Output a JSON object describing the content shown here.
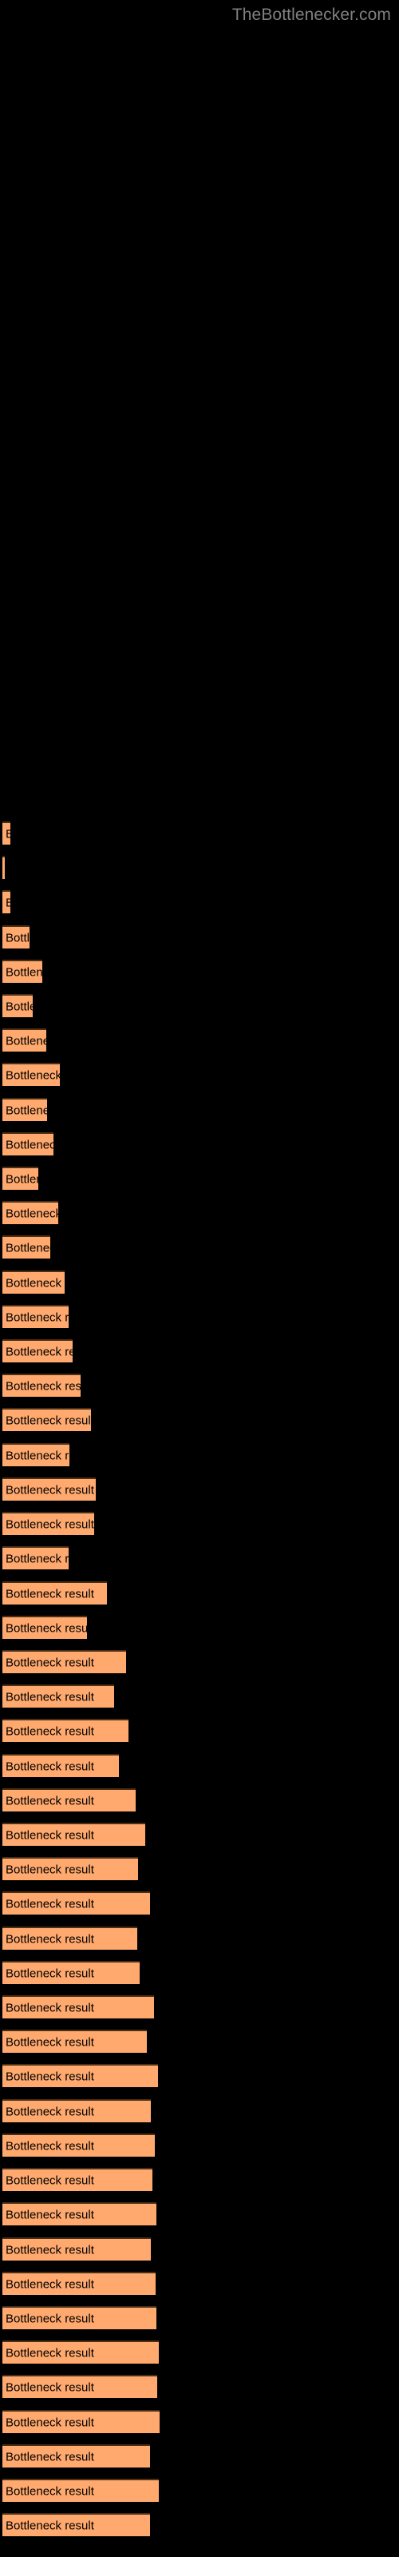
{
  "header": {
    "brand": "TheBottlenecker.com"
  },
  "colors": {
    "background": "#000000",
    "bar_fill": "#ffa96e",
    "bar_border": "#4a2e15",
    "bar_label": "#000000",
    "brand_text": "#808080"
  },
  "chart_data": {
    "type": "bar",
    "orientation": "horizontal",
    "title": "",
    "subtitle": "",
    "xlabel": "",
    "ylabel": "",
    "grid": false,
    "legend": null,
    "xlim": [
      0,
      500
    ],
    "bar_label_text": "Bottleneck result",
    "categories": [
      "Bottleneck result",
      "Bottleneck result",
      "Bottleneck result",
      "Bottleneck result",
      "Bottleneck result",
      "Bottleneck result",
      "Bottleneck result",
      "Bottleneck result",
      "Bottleneck result",
      "Bottleneck result",
      "Bottleneck result",
      "Bottleneck result",
      "Bottleneck result",
      "Bottleneck result",
      "Bottleneck result",
      "Bottleneck result",
      "Bottleneck result",
      "Bottleneck result",
      "Bottleneck result",
      "Bottleneck result",
      "Bottleneck result",
      "Bottleneck result"
    ],
    "values": [
      10,
      3,
      10,
      34,
      50,
      38,
      55,
      72,
      56,
      64,
      45,
      70,
      60,
      78,
      83,
      88,
      82,
      93,
      98,
      103,
      108,
      115
    ],
    "bars": [
      {
        "label": "Bottleneck result",
        "y": 1028,
        "width": 10
      },
      {
        "label": "Bottleneck result",
        "y": 1071,
        "width": 3
      },
      {
        "label": "Bottleneck result",
        "y": 1114,
        "width": 10
      },
      {
        "label": "Bottleneck result",
        "y": 1158,
        "width": 34
      },
      {
        "label": "Bottleneck result",
        "y": 1201,
        "width": 50
      },
      {
        "label": "Bottleneck result",
        "y": 1244,
        "width": 38
      },
      {
        "label": "Bottleneck result",
        "y": 1287,
        "width": 55
      },
      {
        "label": "Bottleneck result",
        "y": 1330,
        "width": 72
      },
      {
        "label": "Bottleneck result",
        "y": 1374,
        "width": 56
      },
      {
        "label": "Bottleneck result",
        "y": 1417,
        "width": 64
      },
      {
        "label": "Bottleneck result",
        "y": 1460,
        "width": 45
      },
      {
        "label": "Bottleneck result",
        "y": 1503,
        "width": 70
      },
      {
        "label": "Bottleneck result",
        "y": 1546,
        "width": 60
      },
      {
        "label": "Bottleneck result",
        "y": 1590,
        "width": 78
      },
      {
        "label": "Bottleneck result",
        "y": 1633,
        "width": 83
      },
      {
        "label": "Bottleneck result",
        "y": 1676,
        "width": 88
      },
      {
        "label": "Bottleneck result",
        "y": 1719,
        "width": 98
      },
      {
        "label": "Bottleneck result",
        "y": 1762,
        "width": 111
      },
      {
        "label": "Bottleneck result",
        "y": 1806,
        "width": 84
      },
      {
        "label": "Bottleneck result",
        "y": 1849,
        "width": 117
      },
      {
        "label": "Bottleneck result",
        "y": 1892,
        "width": 115
      },
      {
        "label": "Bottleneck result",
        "y": 1935,
        "width": 83
      },
      {
        "label": "Bottleneck result",
        "y": 1979,
        "width": 131
      },
      {
        "label": "Bottleneck result",
        "y": 2022,
        "width": 106
      },
      {
        "label": "Bottleneck result",
        "y": 2065,
        "width": 155
      },
      {
        "label": "Bottleneck result",
        "y": 2108,
        "width": 140
      },
      {
        "label": "Bottleneck result",
        "y": 2151,
        "width": 158
      },
      {
        "label": "Bottleneck result",
        "y": 2195,
        "width": 146
      },
      {
        "label": "Bottleneck result",
        "y": 2238,
        "width": 167
      },
      {
        "label": "Bottleneck result",
        "y": 2281,
        "width": 179
      },
      {
        "label": "Bottleneck result",
        "y": 2324,
        "width": 170
      },
      {
        "label": "Bottleneck result",
        "y": 2367,
        "width": 185
      },
      {
        "label": "Bottleneck result",
        "y": 2411,
        "width": 169
      },
      {
        "label": "Bottleneck result",
        "y": 2454,
        "width": 172
      },
      {
        "label": "Bottleneck result",
        "y": 2497,
        "width": 190
      },
      {
        "label": "Bottleneck result",
        "y": 2540,
        "width": 181
      },
      {
        "label": "Bottleneck result",
        "y": 2583,
        "width": 195
      },
      {
        "label": "Bottleneck result",
        "y": 2627,
        "width": 186
      },
      {
        "label": "Bottleneck result",
        "y": 2670,
        "width": 191
      },
      {
        "label": "Bottleneck result",
        "y": 2713,
        "width": 188
      },
      {
        "label": "Bottleneck result",
        "y": 2756,
        "width": 193
      },
      {
        "label": "Bottleneck result",
        "y": 2800,
        "width": 186
      },
      {
        "label": "Bottleneck result",
        "y": 2843,
        "width": 192
      },
      {
        "label": "Bottleneck result",
        "y": 2886,
        "width": 193
      },
      {
        "label": "Bottleneck result",
        "y": 2929,
        "width": 196
      },
      {
        "label": "Bottleneck result",
        "y": 2972,
        "width": 194
      },
      {
        "label": "Bottleneck result",
        "y": 3016,
        "width": 197
      },
      {
        "label": "Bottleneck result",
        "y": 3059,
        "width": 185
      },
      {
        "label": "Bottleneck result",
        "y": 3102,
        "width": 196
      },
      {
        "label": "Bottleneck result",
        "y": 3145,
        "width": 185
      }
    ]
  }
}
